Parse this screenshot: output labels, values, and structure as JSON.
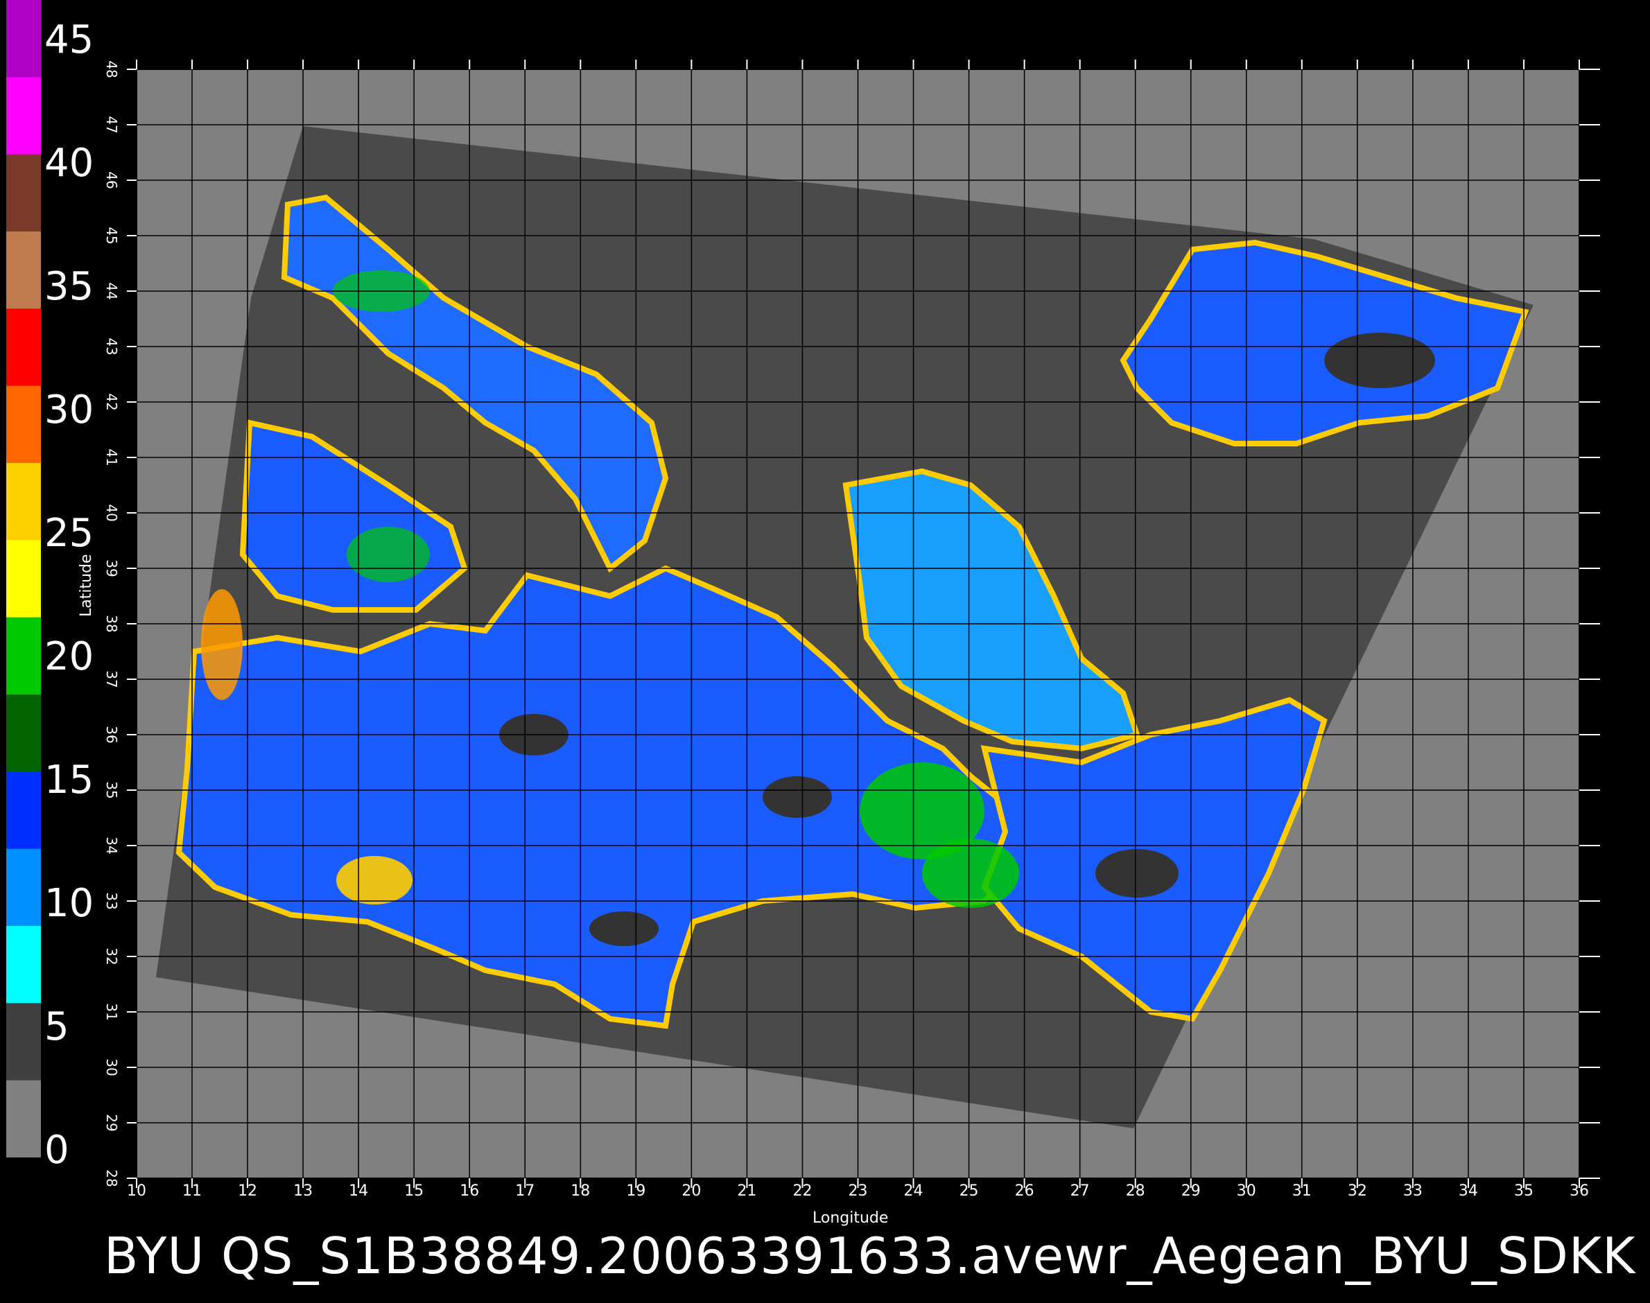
{
  "footer": {
    "title": "BYU  QS_S1B38849.20063391633.avewr_Aegean_BYU_SDKK"
  },
  "colorbar": {
    "labels": [
      "45",
      "40",
      "35",
      "30",
      "25",
      "20",
      "15",
      "10",
      "5",
      "0"
    ],
    "segments": [
      {
        "color": "#b000c8"
      },
      {
        "color": "#ff00ff"
      },
      {
        "color": "#7a3a2a"
      },
      {
        "color": "#c07a50"
      },
      {
        "color": "#ff0000"
      },
      {
        "color": "#ff6600"
      },
      {
        "color": "#ffd000"
      },
      {
        "color": "#ffff00"
      },
      {
        "color": "#00c800"
      },
      {
        "color": "#006400"
      },
      {
        "color": "#0030ff"
      },
      {
        "color": "#0090ff"
      },
      {
        "color": "#00ffff"
      },
      {
        "color": "#404040"
      },
      {
        "color": "#808080"
      }
    ]
  },
  "axes": {
    "longitude_title": "Longitude",
    "latitude_title": "Latitude",
    "lon_ticks": [
      "10",
      "11",
      "12",
      "13",
      "14",
      "15",
      "16",
      "17",
      "18",
      "19",
      "20",
      "21",
      "22",
      "23",
      "24",
      "25",
      "26",
      "27",
      "28",
      "29",
      "30",
      "31",
      "32",
      "33",
      "34",
      "35",
      "36"
    ],
    "lat_ticks": [
      "48",
      "47",
      "46",
      "45",
      "44",
      "43",
      "42",
      "41",
      "40",
      "39",
      "38",
      "37",
      "36",
      "35",
      "34",
      "33",
      "32",
      "31",
      "30",
      "29",
      "28"
    ]
  },
  "colors": {
    "land": "#808080",
    "swath": "#4a4a4a",
    "grid": "#000000",
    "sea_blue": "#1a5cff",
    "sea_cyan": "#19b8ff"
  }
}
